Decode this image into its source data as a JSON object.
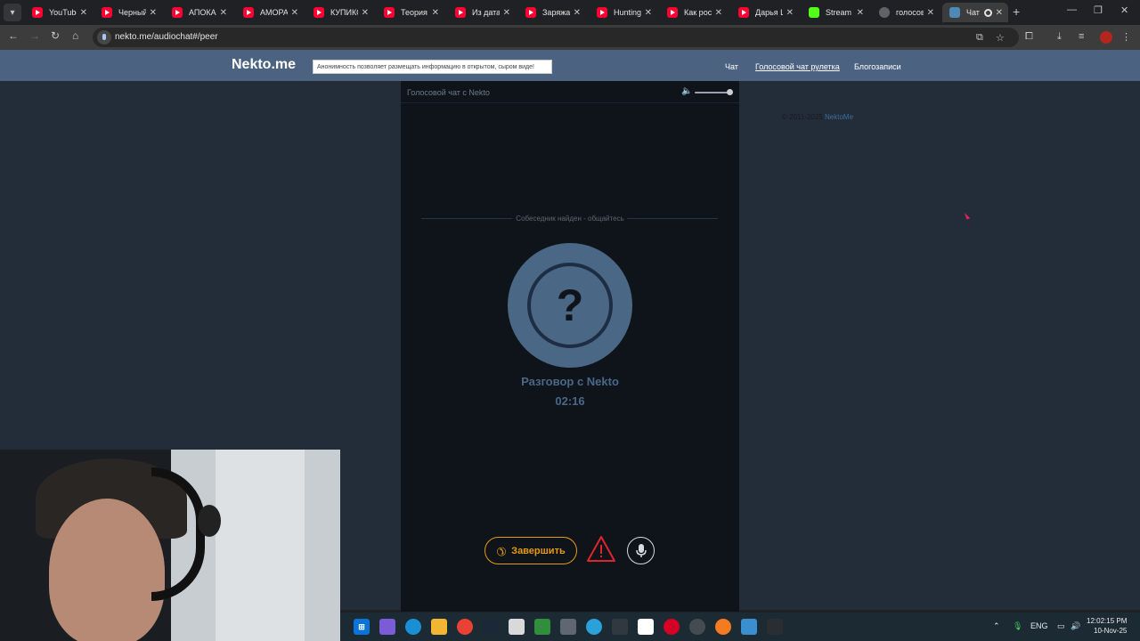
{
  "browser": {
    "tabs": [
      {
        "title": "YouTube",
        "favicon": "youtube-icon"
      },
      {
        "title": "Черный",
        "favicon": "youtube-icon"
      },
      {
        "title": "АПОКАЛ",
        "favicon": "youtube-icon"
      },
      {
        "title": "АМОРАЛ",
        "favicon": "youtube-icon"
      },
      {
        "title": "КУПИКО",
        "favicon": "youtube-icon"
      },
      {
        "title": "Теория",
        "favicon": "youtube-icon"
      },
      {
        "title": "Из дата",
        "favicon": "youtube-icon"
      },
      {
        "title": "Заряжа",
        "favicon": "youtube-icon"
      },
      {
        "title": "Hunting",
        "favicon": "youtube-icon"
      },
      {
        "title": "Как рос",
        "favicon": "youtube-icon"
      },
      {
        "title": "Дарья Ш",
        "favicon": "youtube-icon"
      },
      {
        "title": "Stream",
        "favicon": "kick-icon"
      },
      {
        "title": "голосов",
        "favicon": "globe-icon"
      },
      {
        "title": "Чат",
        "favicon": "nekto-icon",
        "active": true,
        "recording": true
      }
    ],
    "url": "nekto.me/audiochat#/peer",
    "new_tab": "+"
  },
  "site": {
    "logo": "Nekto.me",
    "notice": "Анонимность позволяет размещать информацию в открытом, сыром виде!",
    "nav": [
      "Чат",
      "Голосовой чат рулетка",
      "Блогозаписи"
    ]
  },
  "panel": {
    "title": "Голосовой чат с Nekto",
    "volume": 1.0,
    "status": "Собеседник найден - общайтесь",
    "avatar_symbol": "?",
    "peer_name": "Разговор с Nekto",
    "timer": "02:16",
    "end_label": "Завершить"
  },
  "footer": {
    "copyright": "© 2011-2025",
    "link": "NektoMe"
  },
  "system": {
    "lang": "ENG",
    "time": "12:02:15 PM",
    "date": "10-Nov-25"
  },
  "colors": {
    "header": "#4b6381",
    "page_bg": "#232d39",
    "panel_bg": "#0f141b",
    "accent_blue": "#4a6786",
    "end_orange": "#e49b14",
    "report_red": "#e0242b"
  }
}
